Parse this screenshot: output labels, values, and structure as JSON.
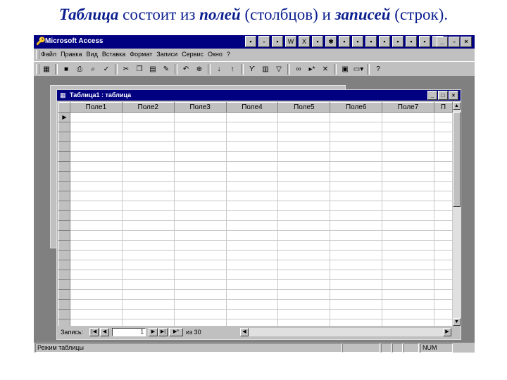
{
  "heading": {
    "w1": "Таблица",
    "w2": " состоит из ",
    "w3": "полей",
    "w4": " (столбцов) и ",
    "w5": "записей",
    "w6": " (строк)."
  },
  "app": {
    "title": "Microsoft Access",
    "menu": [
      "Файл",
      "Правка",
      "Вид",
      "Вставка",
      "Формат",
      "Записи",
      "Сервис",
      "Окно",
      "?"
    ],
    "toolbar_icons": [
      "view-icon",
      "save-icon",
      "print-icon",
      "preview-icon",
      "spelling-icon",
      "cut-icon",
      "copy-icon",
      "paste-icon",
      "format-painter-icon",
      "undo-icon",
      "hyperlink-icon",
      "sort-asc-icon",
      "sort-desc-icon",
      "filter-selection-icon",
      "filter-form-icon",
      "apply-filter-icon",
      "find-icon",
      "new-record-icon",
      "delete-record-icon",
      "database-window-icon",
      "new-object-icon",
      "help-icon"
    ],
    "status_text": "Режим таблицы",
    "status_num": "NUM"
  },
  "table_window": {
    "title": "Таблица1 : таблица",
    "columns": [
      "Поле1",
      "Поле2",
      "Поле3",
      "Поле4",
      "Поле5",
      "Поле6",
      "Поле7",
      "П"
    ],
    "row_count": 23,
    "nav": {
      "label": "Запись:",
      "current": "1",
      "of_label": "из",
      "total": "30"
    }
  }
}
